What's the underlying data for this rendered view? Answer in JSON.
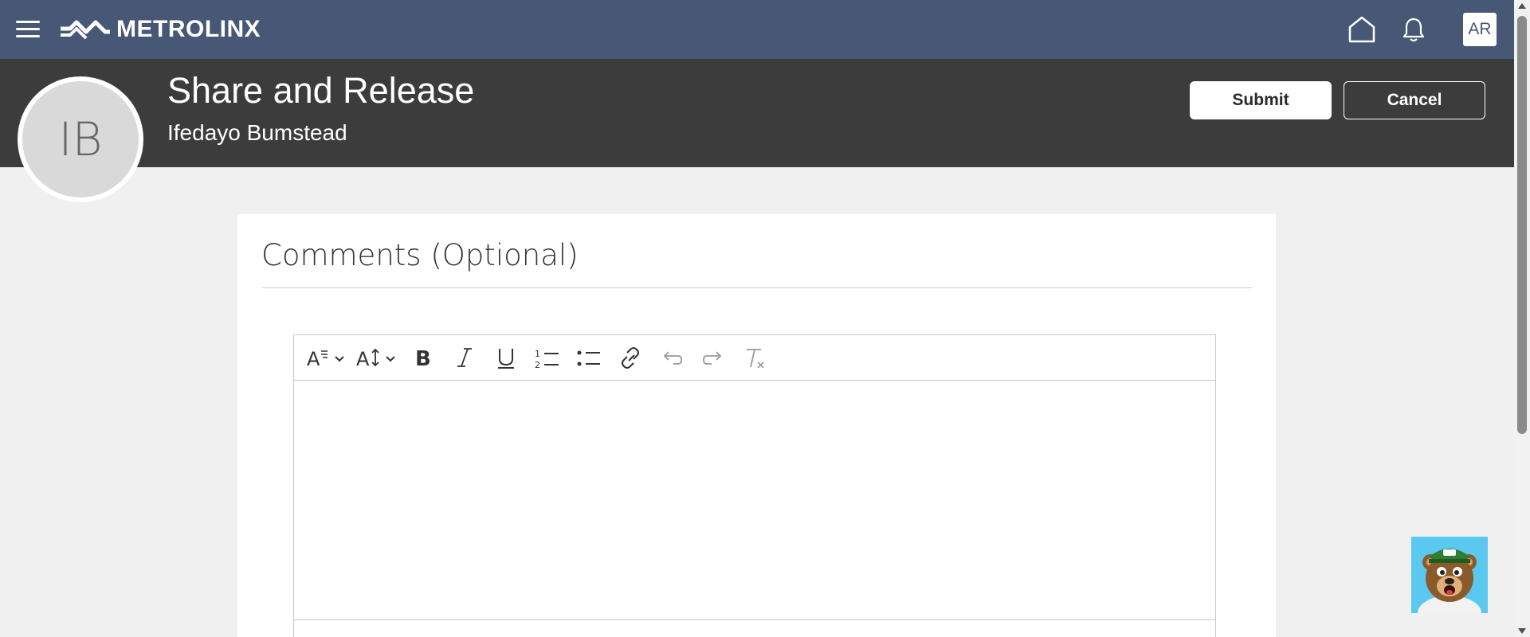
{
  "brand": {
    "name": "METROLINX",
    "color": "#475877"
  },
  "nav": {
    "home_icon": "home-icon",
    "notifications_icon": "bell-icon",
    "user_initials": "AR"
  },
  "header": {
    "title": "Share and Release",
    "subtitle": "Ifedayo Bumstead",
    "avatar_initials": "IB",
    "submit_label": "Submit",
    "cancel_label": "Cancel"
  },
  "comments": {
    "title": "Comments (Optional)",
    "value": ""
  },
  "editor": {
    "toolbar": [
      {
        "name": "font-style",
        "icon": "font-style-icon"
      },
      {
        "name": "font-size",
        "icon": "font-size-icon"
      },
      {
        "name": "bold",
        "icon": "bold-icon"
      },
      {
        "name": "italic",
        "icon": "italic-icon"
      },
      {
        "name": "underline",
        "icon": "underline-icon"
      },
      {
        "name": "numbered-list",
        "icon": "numbered-list-icon"
      },
      {
        "name": "bulleted-list",
        "icon": "bulleted-list-icon"
      },
      {
        "name": "link",
        "icon": "link-icon"
      },
      {
        "name": "undo",
        "icon": "undo-icon"
      },
      {
        "name": "redo",
        "icon": "redo-icon"
      },
      {
        "name": "clear-formatting",
        "icon": "clear-formatting-icon"
      }
    ]
  },
  "colors": {
    "topbar": "#475877",
    "header": "#3c3c3c",
    "page_background": "#f0f0f0"
  },
  "mascot": {
    "icon": "bear-mascot-icon"
  }
}
